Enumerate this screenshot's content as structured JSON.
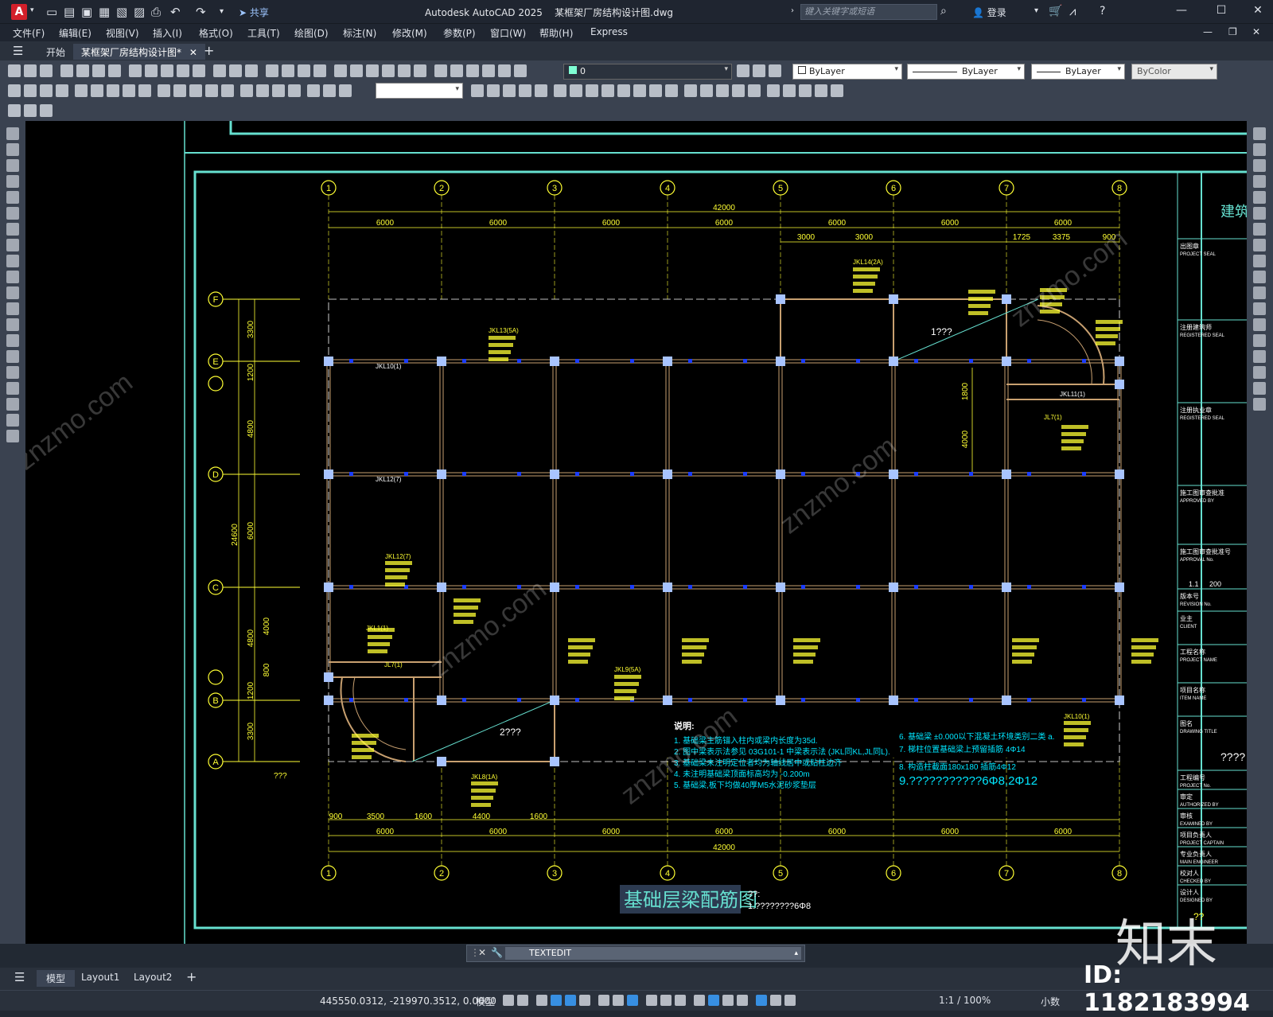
{
  "titlebar": {
    "share_label": "共享",
    "title_app": "Autodesk AutoCAD 2025",
    "title_file": "某框架厂房结构设计图.dwg",
    "search_placeholder": "键入关键字或短语",
    "login_label": "登录"
  },
  "menu": [
    "文件(F)",
    "编辑(E)",
    "视图(V)",
    "插入(I)",
    "格式(O)",
    "工具(T)",
    "绘图(D)",
    "标注(N)",
    "修改(M)",
    "参数(P)",
    "窗口(W)",
    "帮助(H)",
    "Express"
  ],
  "filetabs": {
    "start": "开始",
    "doc": "某框架厂房结构设计图*"
  },
  "layer_combo": "0",
  "props": {
    "color": "ByLayer",
    "linetype": "ByLayer",
    "lineweight": "ByLayer",
    "plotstyle": "ByColor"
  },
  "drawing": {
    "axes_x": [
      "1",
      "2",
      "3",
      "4",
      "5",
      "6",
      "7",
      "8"
    ],
    "axes_y": [
      "F",
      "E",
      "D",
      "C",
      "B",
      "A"
    ],
    "top_total": "42000",
    "top_spans": [
      "6000",
      "6000",
      "6000",
      "6000",
      "6000",
      "6000",
      "6000"
    ],
    "top_sub": [
      "3000",
      "3000",
      "1725",
      "3375",
      "900"
    ],
    "bottom_total": "42000",
    "bottom_spans": [
      "6000",
      "6000",
      "6000",
      "6000",
      "6000",
      "6000",
      "6000"
    ],
    "bottom_sub": [
      "900",
      "3500",
      "1600",
      "4400",
      "1600"
    ],
    "left_total": "24600",
    "left_dims": [
      "3300",
      "1200",
      "4800",
      "6000",
      "4800",
      "4000",
      "800",
      "1200",
      "3300"
    ],
    "right_dims": [
      "1800",
      "4000"
    ],
    "beam_labels": [
      "JKL10(1)",
      "JKL12(7)",
      "JKL1(1)",
      "JL7(1)",
      "JKL14(2A)",
      "JKL13(5A)",
      "JKL12(7)",
      "JKL9(5A)",
      "JKL8(1A)",
      "JKL11(1)",
      "JL7(1)",
      "JKL10(1)"
    ],
    "notes_title": "说明:",
    "notes_left": [
      "1. 基础梁主筋锚入柱内或梁内长度为35d.",
      "2. 图中梁表示法参见 03G101-1 中梁表示法 (JKL同KL,JL同L).",
      "3. 基础梁未注明定位者均为轴线居中或贴柱边齐",
      "4. 未注明基础梁顶面标高均为 -0.200m",
      "5. 基础梁,板下均做40厚M5水泥砂浆垫层"
    ],
    "notes_right": [
      "6. 基础梁 ±0.000以下混凝土环境类别二类 a.",
      "7. 梯柱位置基础梁上预留插筋 4Φ14",
      "8. 构造柱截面180x180  插筋4Φ12"
    ],
    "note9": "9.???????????6Φ8,2Φ12",
    "drawing_title": "基础层梁配筋图",
    "title_note": "??:",
    "title_note2": "1.????????6Φ8",
    "q1": "1???",
    "q2": "2???",
    "scale_note": "???",
    "tb_heading": "建筑",
    "tb_rows": [
      [
        "出图章",
        "PROJECT SEAL"
      ],
      [
        "注册建筑师",
        "REGISTERED SEAL"
      ],
      [
        "注册执业章",
        "REGISTERED SEAL"
      ],
      [
        "施工图审查批准",
        "APPROVED BY"
      ],
      [
        "施工图审查批准号",
        "APPROVAL No."
      ],
      [
        "版本号",
        "REVISION No."
      ],
      [
        "业主",
        "CLIENT"
      ],
      [
        "工程名称",
        "PROJECT NAME"
      ],
      [
        "项目名称",
        "ITEM NAME"
      ],
      [
        "图名",
        "DRAWING TITLE"
      ],
      [
        "工程编号",
        "PROJECT No."
      ],
      [
        "审定",
        "AUTHORIZED BY"
      ],
      [
        "审核",
        "EXAMINED BY"
      ],
      [
        "项目负责人",
        "PROJECT CAPTAIN"
      ],
      [
        "专业负责人",
        "MAIN ENGINEER"
      ],
      [
        "校对人",
        "CHECKED BY"
      ],
      [
        "设计人",
        "DESIGNED BY"
      ]
    ],
    "tb_rev": "1.1",
    "tb_rev2": "200",
    "tb_title_q": "????",
    "tb_type_q": "??"
  },
  "cmdline": "TEXTEDIT",
  "layout_tabs": [
    "模型",
    "Layout1",
    "Layout2"
  ],
  "status": {
    "coords": "445550.0312, -219970.3512, 0.0000",
    "model": "模型",
    "scale": "1:1 / 100%",
    "units": "小数"
  },
  "watermark": {
    "id": "ID: 1182183994",
    "logo": "知末",
    "site": "znzmo.com"
  }
}
